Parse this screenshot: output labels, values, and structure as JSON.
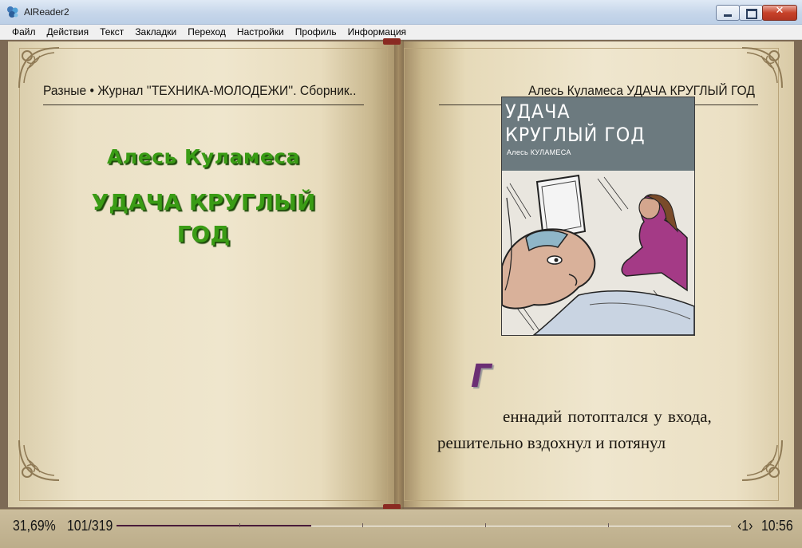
{
  "window": {
    "title": "AlReader2"
  },
  "menu": [
    "Файл",
    "Действия",
    "Текст",
    "Закладки",
    "Переход",
    "Настройки",
    "Профиль",
    "Информация"
  ],
  "left_page": {
    "header": "Разные • Журнал ''ТЕХНИКА-МОЛОДЕЖИ''. Сборник..",
    "author": "Алесь Куламеса",
    "title_line1": "УДАЧА КРУГЛЫЙ",
    "title_line2": "ГОД"
  },
  "right_page": {
    "header": "Алесь Куламеса УДАЧА КРУГЛЫЙ ГОД",
    "cover": {
      "title_line1": "УДАЧА",
      "title_line2": "КРУГЛЫЙ ГОД",
      "author": "Алесь КУЛАМЕСА"
    },
    "dropcap": "Г",
    "line1": "еннадий  потоптался  у  входа,",
    "line2": "решительно   вздохнул   и   потянул"
  },
  "status": {
    "percent": "31,69%",
    "pages": "101/319",
    "progress_fraction": 0.3169,
    "page_indicator": "‹1›",
    "clock": "10:56"
  },
  "colors": {
    "title_green": "#3a9c15",
    "dropcap_purple": "#6b2f74",
    "progress": "#4a1b3a"
  }
}
